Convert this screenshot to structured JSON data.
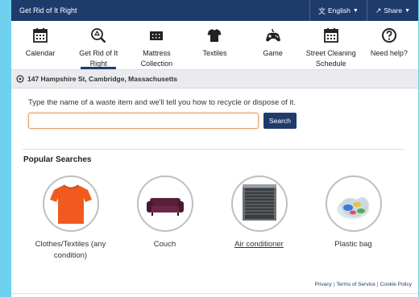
{
  "app": {
    "title": "Get Rid of It Right"
  },
  "topbar": {
    "language_label": "English",
    "share_label": "Share"
  },
  "nav": {
    "items": [
      {
        "label": "Calendar",
        "icon": "calendar-icon"
      },
      {
        "label": "Get Rid of It Right",
        "icon": "recycle-search-icon",
        "active": true
      },
      {
        "label": "Mattress Collection",
        "icon": "mattress-icon"
      },
      {
        "label": "Textiles",
        "icon": "shirt-icon"
      },
      {
        "label": "Game",
        "icon": "gamepad-icon"
      },
      {
        "label": "Street Cleaning Schedule",
        "icon": "calendar-icon"
      },
      {
        "label": "Need help?",
        "icon": "help-icon"
      }
    ]
  },
  "address": {
    "text": "147 Hampshire St, Cambridge, Massachusetts"
  },
  "search": {
    "prompt": "Type the name of a waste item and we'll tell you how to recycle or dispose of it.",
    "value": "",
    "button_label": "Search"
  },
  "popular": {
    "heading": "Popular Searches",
    "items": [
      {
        "label": "Clothes/Textiles (any condition)",
        "icon": "tshirt-image"
      },
      {
        "label": "Couch",
        "icon": "couch-image"
      },
      {
        "label": "Air conditioner",
        "icon": "air-conditioner-image"
      },
      {
        "label": "Plastic bag",
        "icon": "plastic-bag-image"
      }
    ]
  },
  "footer": {
    "privacy": "Privacy",
    "terms": "Terms of Service",
    "cookie": "Cookie Policy"
  },
  "colors": {
    "brand": "#1f3b6b",
    "page_background": "#6fd0f0",
    "input_focus": "#e8a163"
  }
}
